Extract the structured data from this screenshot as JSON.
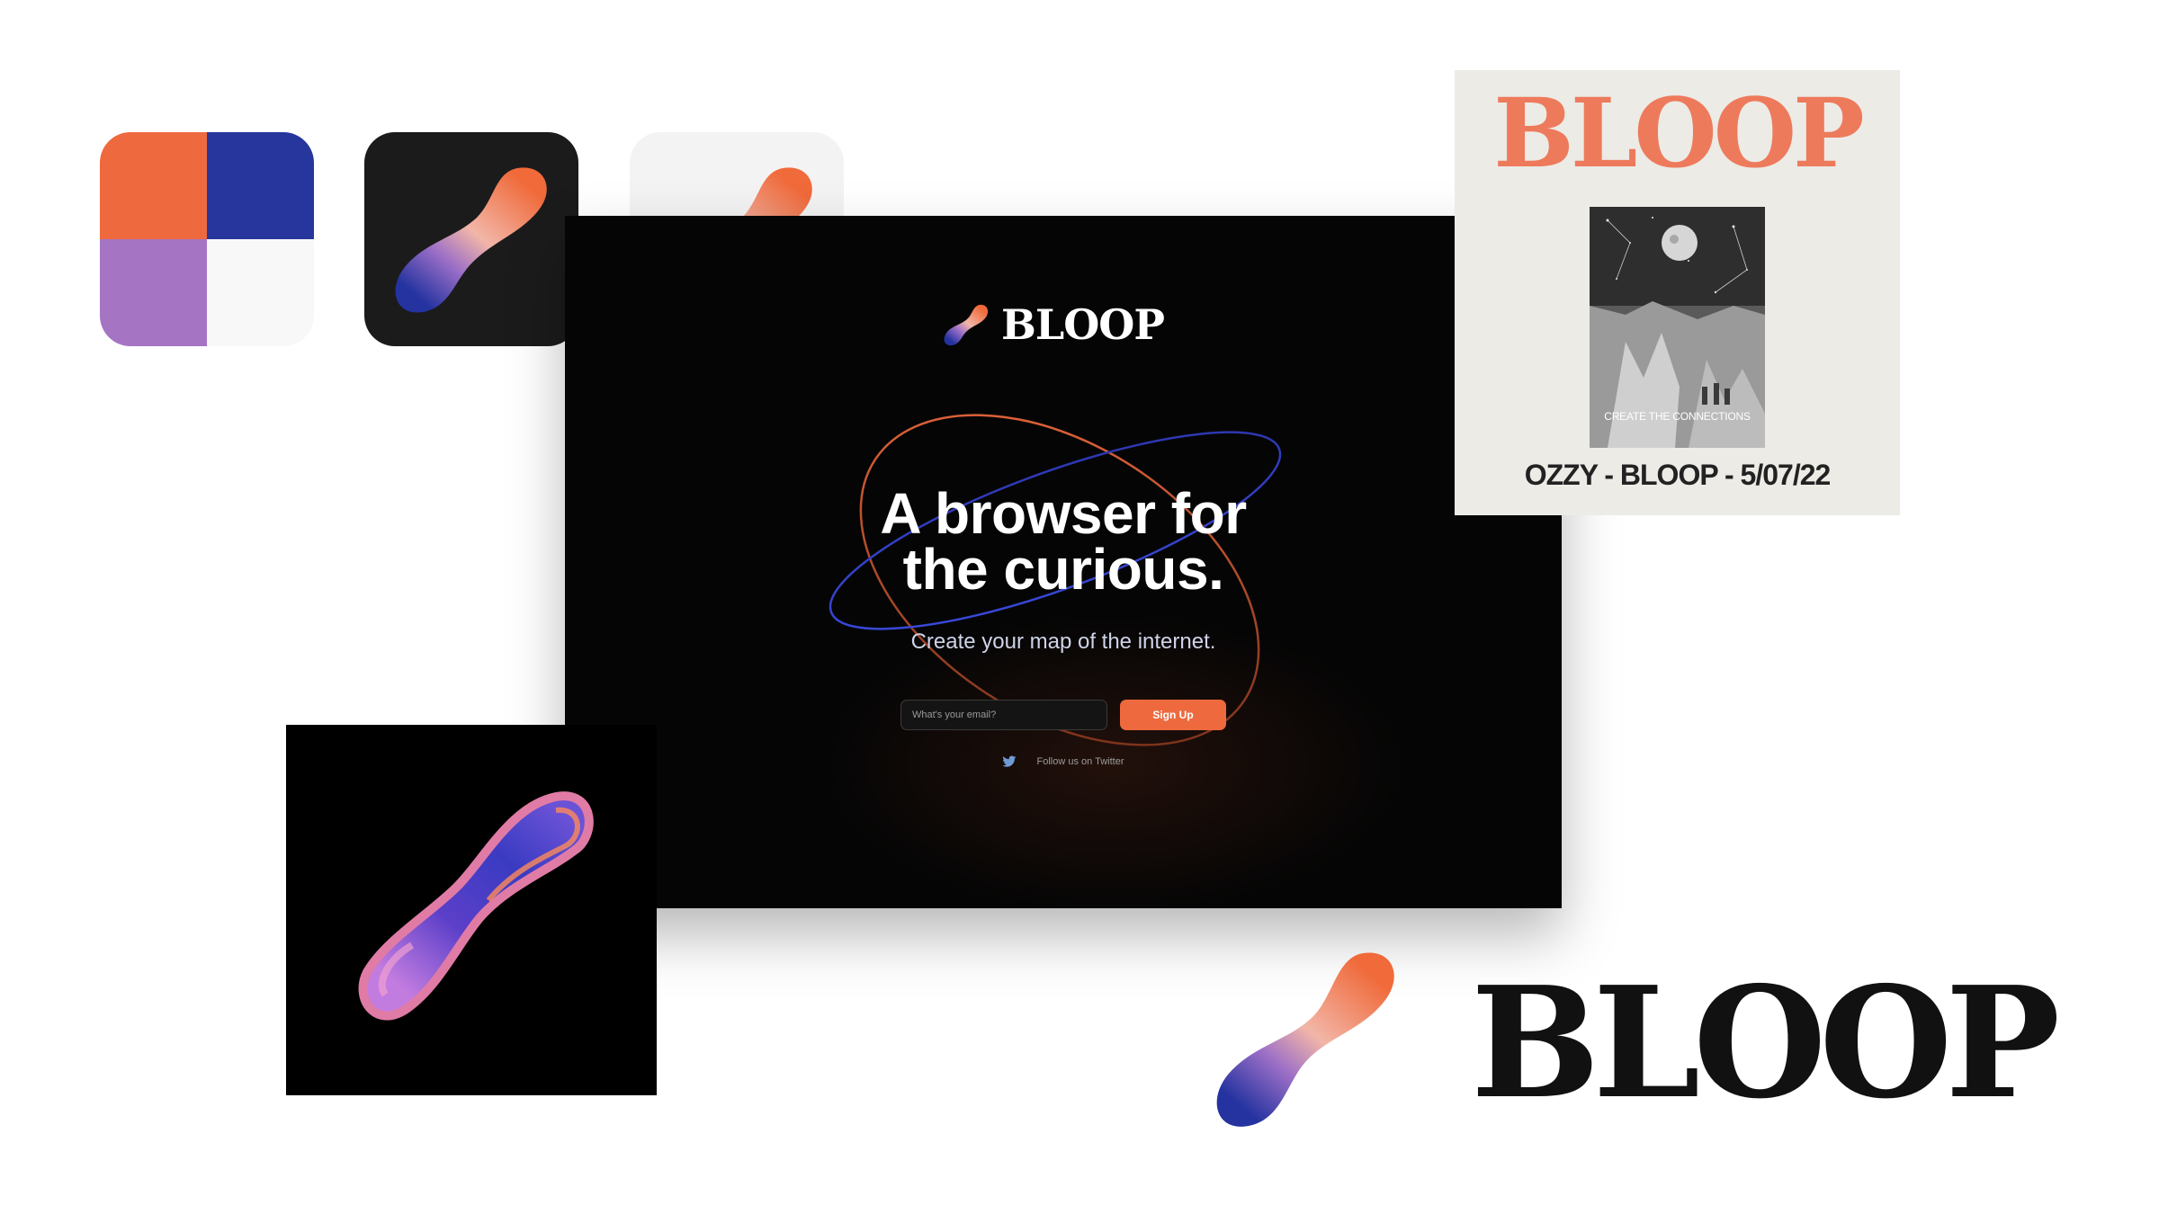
{
  "brand": {
    "name": "BLOOP",
    "colors": {
      "orange": "#ee6a3e",
      "blue": "#27369c",
      "purple": "#a575c4",
      "off_white": "#f8f8f8",
      "dark": "#1c1b1c"
    }
  },
  "icons": [
    {
      "name": "color-grid-icon"
    },
    {
      "name": "bloop-mark-dark-icon"
    },
    {
      "name": "bloop-mark-light-icon"
    }
  ],
  "site": {
    "logo_text": "BLOOP",
    "headline_line1": "A browser for",
    "headline_line2": "the curious.",
    "subheadline": "Create your map of the internet.",
    "email_placeholder": "What's your email?",
    "signup_label": "Sign Up",
    "twitter_label": "Follow us on Twitter"
  },
  "poster": {
    "title": "BLOOP",
    "tagline": "CREATE THE CONNECTIONS",
    "footer": "OZZY - BLOOP - 5/07/22"
  },
  "wordmark": {
    "text": "BLOOP"
  }
}
